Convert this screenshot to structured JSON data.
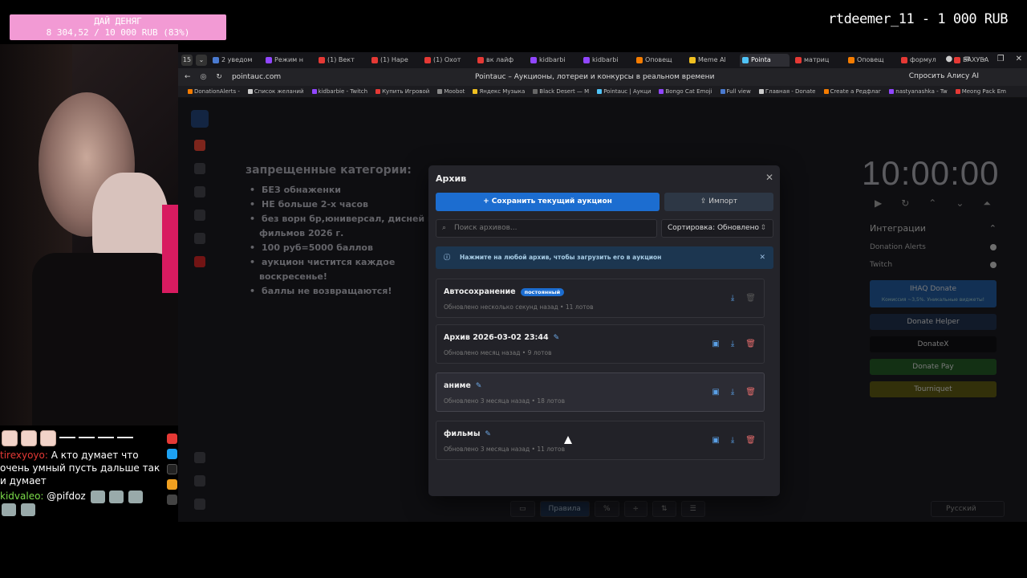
{
  "overlay": {
    "goal_title": "ДАЙ ДЕНЯГ",
    "goal_progress": "8 304,52 / 10 000 RUB (83%)",
    "top_donor": "rtdeemer_11 - 1 000 RUB"
  },
  "chat": {
    "msg1_user": "tirexyoyo:",
    "msg1_text": "А кто думает что очень умный пусть дальше так и думает",
    "msg2_user": "kidvaleo:",
    "msg2_text": "@pifdoz"
  },
  "browser": {
    "tabs": [
      {
        "label": "2 уведом",
        "color": "#4a7ad0"
      },
      {
        "label": "Режим н",
        "color": "#9146ff"
      },
      {
        "label": "(1) Вект",
        "color": "#e53935"
      },
      {
        "label": "(1) Наре",
        "color": "#e53935"
      },
      {
        "label": "(1) Охот",
        "color": "#e53935"
      },
      {
        "label": "вк лайф",
        "color": "#e53935"
      },
      {
        "label": "kidbarbi",
        "color": "#9146ff"
      },
      {
        "label": "kidbarbi",
        "color": "#9146ff"
      },
      {
        "label": "Оповещ",
        "color": "#f57c00"
      },
      {
        "label": "Meme Al",
        "color": "#f0c020"
      },
      {
        "label": "Pointa",
        "color": "#4fc3f7"
      },
      {
        "label": "матриц",
        "color": "#e53935"
      },
      {
        "label": "Оповещ",
        "color": "#f57c00"
      },
      {
        "label": "формул",
        "color": "#e53935"
      },
      {
        "label": "БАХУБА",
        "color": "#e53935"
      }
    ],
    "url": "pointauc.com",
    "page_title": "Pointauc – Аукционы, лотереи и конкурсы в реальном времени",
    "alisa_button": "Спросить Алису AI",
    "bookmarks": [
      {
        "label": "DonationAlerts -",
        "color": "#f57c00"
      },
      {
        "label": "Список желаний",
        "color": "#cccccc"
      },
      {
        "label": "kidbarbie - Twitch",
        "color": "#9146ff"
      },
      {
        "label": "Купить Игровой",
        "color": "#e53935"
      },
      {
        "label": "Moobot",
        "color": "#888888"
      },
      {
        "label": "Яндекс Музыка",
        "color": "#f0c020"
      },
      {
        "label": "Black Desert — M",
        "color": "#666666"
      },
      {
        "label": "Pointauc | Аукци",
        "color": "#4fc3f7"
      },
      {
        "label": "Bongo Cat Emoji",
        "color": "#9146ff"
      },
      {
        "label": "Full view",
        "color": "#4a7ad0"
      },
      {
        "label": "Главная - Donate",
        "color": "#cccccc"
      },
      {
        "label": "Create a Редфлаг",
        "color": "#f57c00"
      },
      {
        "label": "nastyanashka - Tw",
        "color": "#9146ff"
      },
      {
        "label": "Meong Pack Em",
        "color": "#e53935"
      }
    ]
  },
  "page": {
    "rules_title": "запрещенные категории:",
    "rules": [
      "БЕЗ обнаженки",
      "НЕ больше 2-х часов",
      "без ворн бр,юниверсал, дисней и",
      "фильмов 2026 г.",
      "100 руб=5000 баллов",
      "аукцион чистится каждое",
      "воскресенье!",
      "баллы не возвращаются!"
    ],
    "timer": "10:00:00",
    "integrations_title": "Интеграции",
    "integrations": [
      "Donation Alerts",
      "Twitch"
    ],
    "services": {
      "ihaq": "IHAQ Donate",
      "ihaq_sub": "Комиссия ~3,5%. Уникальные виджеты!",
      "helper": "Donate Helper",
      "donatex": "DonateX",
      "donatepay": "Donate Pay",
      "tourniquet": "Tourniquet"
    },
    "bottom_rules": "Правила",
    "language": "Русский"
  },
  "modal": {
    "title": "Архив",
    "save_button": "+ Сохранить текущий аукцион",
    "import_button": "Импорт",
    "search_placeholder": "Поиск архивов...",
    "sort_label": "Сортировка: Обновлено",
    "info_text": "Нажмите на любой архив, чтобы загрузить его в аукцион",
    "archives": [
      {
        "name": "Автосохранение",
        "badge": "постоянный",
        "meta": "Обновлено несколько секунд назад • 11 лотов"
      },
      {
        "name": "Архив 2026-03-02 23:44",
        "meta": "Обновлено месяц назад • 9 лотов"
      },
      {
        "name": "аниме",
        "meta": "Обновлено 3 месяца назад • 18 лотов"
      },
      {
        "name": "фильмы",
        "meta": "Обновлено 3 месяца назад • 11 лотов"
      }
    ]
  }
}
